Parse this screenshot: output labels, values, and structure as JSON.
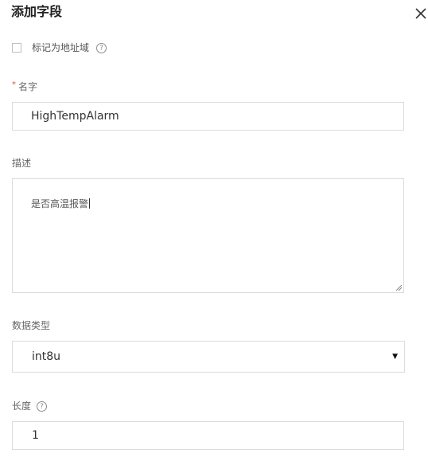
{
  "dialog": {
    "title": "添加字段",
    "close_icon": "close-icon"
  },
  "address_field": {
    "label": "标记为地址域",
    "checked": false,
    "help_glyph": "?"
  },
  "name": {
    "required_mark": "*",
    "label": "名字",
    "value": "HighTempAlarm"
  },
  "description": {
    "label": "描述",
    "value": "是否高温报警"
  },
  "data_type": {
    "label": "数据类型",
    "selected": "int8u",
    "caret": "▼"
  },
  "length": {
    "label": "长度",
    "help_glyph": "?",
    "value": "1"
  }
}
